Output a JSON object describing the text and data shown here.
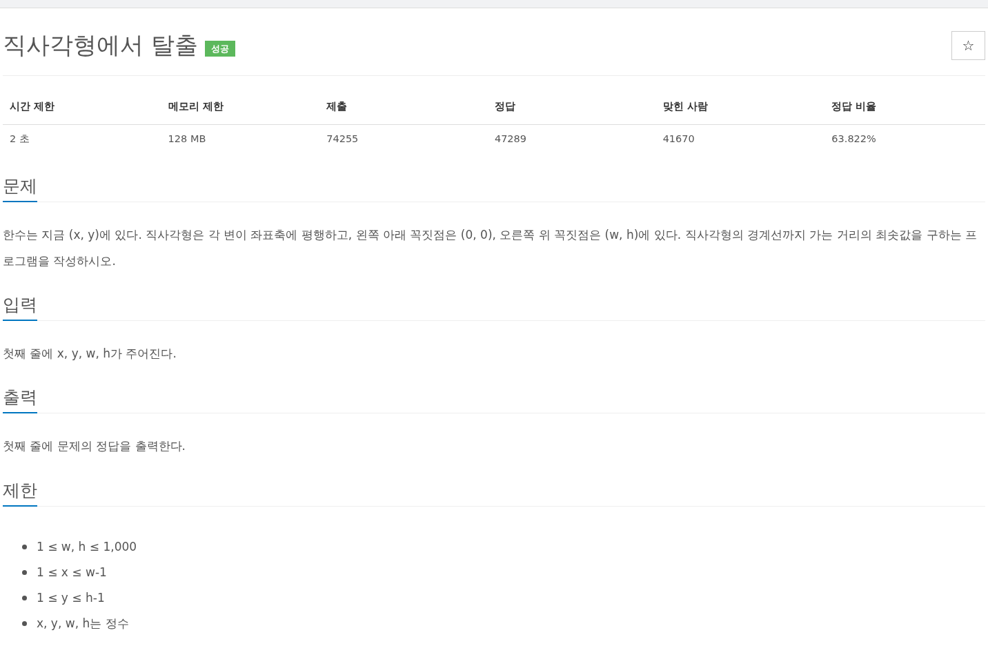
{
  "title": "직사각형에서 탈출",
  "status_badge": "성공",
  "star_button": "☆",
  "info_table": {
    "columns": [
      "시간 제한",
      "메모리 제한",
      "제출",
      "정답",
      "맞힌 사람",
      "정답 비율"
    ],
    "rows": [
      [
        "2 초",
        "128 MB",
        "74255",
        "47289",
        "41670",
        "63.822%"
      ]
    ]
  },
  "sections": [
    {
      "heading": "문제",
      "kind": "paragraph",
      "text": "한수는 지금 (x, y)에 있다. 직사각형은 각 변이 좌표축에 평행하고, 왼쪽 아래 꼭짓점은 (0, 0), 오른쪽 위 꼭짓점은 (w, h)에 있다. 직사각형의 경계선까지 가는 거리의 최솟값을 구하는 프로그램을 작성하시오."
    },
    {
      "heading": "입력",
      "kind": "paragraph",
      "text": "첫째 줄에 x, y, w, h가 주어진다."
    },
    {
      "heading": "출력",
      "kind": "paragraph",
      "text": "첫째 줄에 문제의 정답을 출력한다."
    },
    {
      "heading": "제한",
      "kind": "list",
      "items": [
        "1 ≤ w, h ≤ 1,000",
        "1 ≤ x ≤ w-1",
        "1 ≤ y ≤ h-1",
        "x, y, w, h는 정수"
      ]
    }
  ]
}
